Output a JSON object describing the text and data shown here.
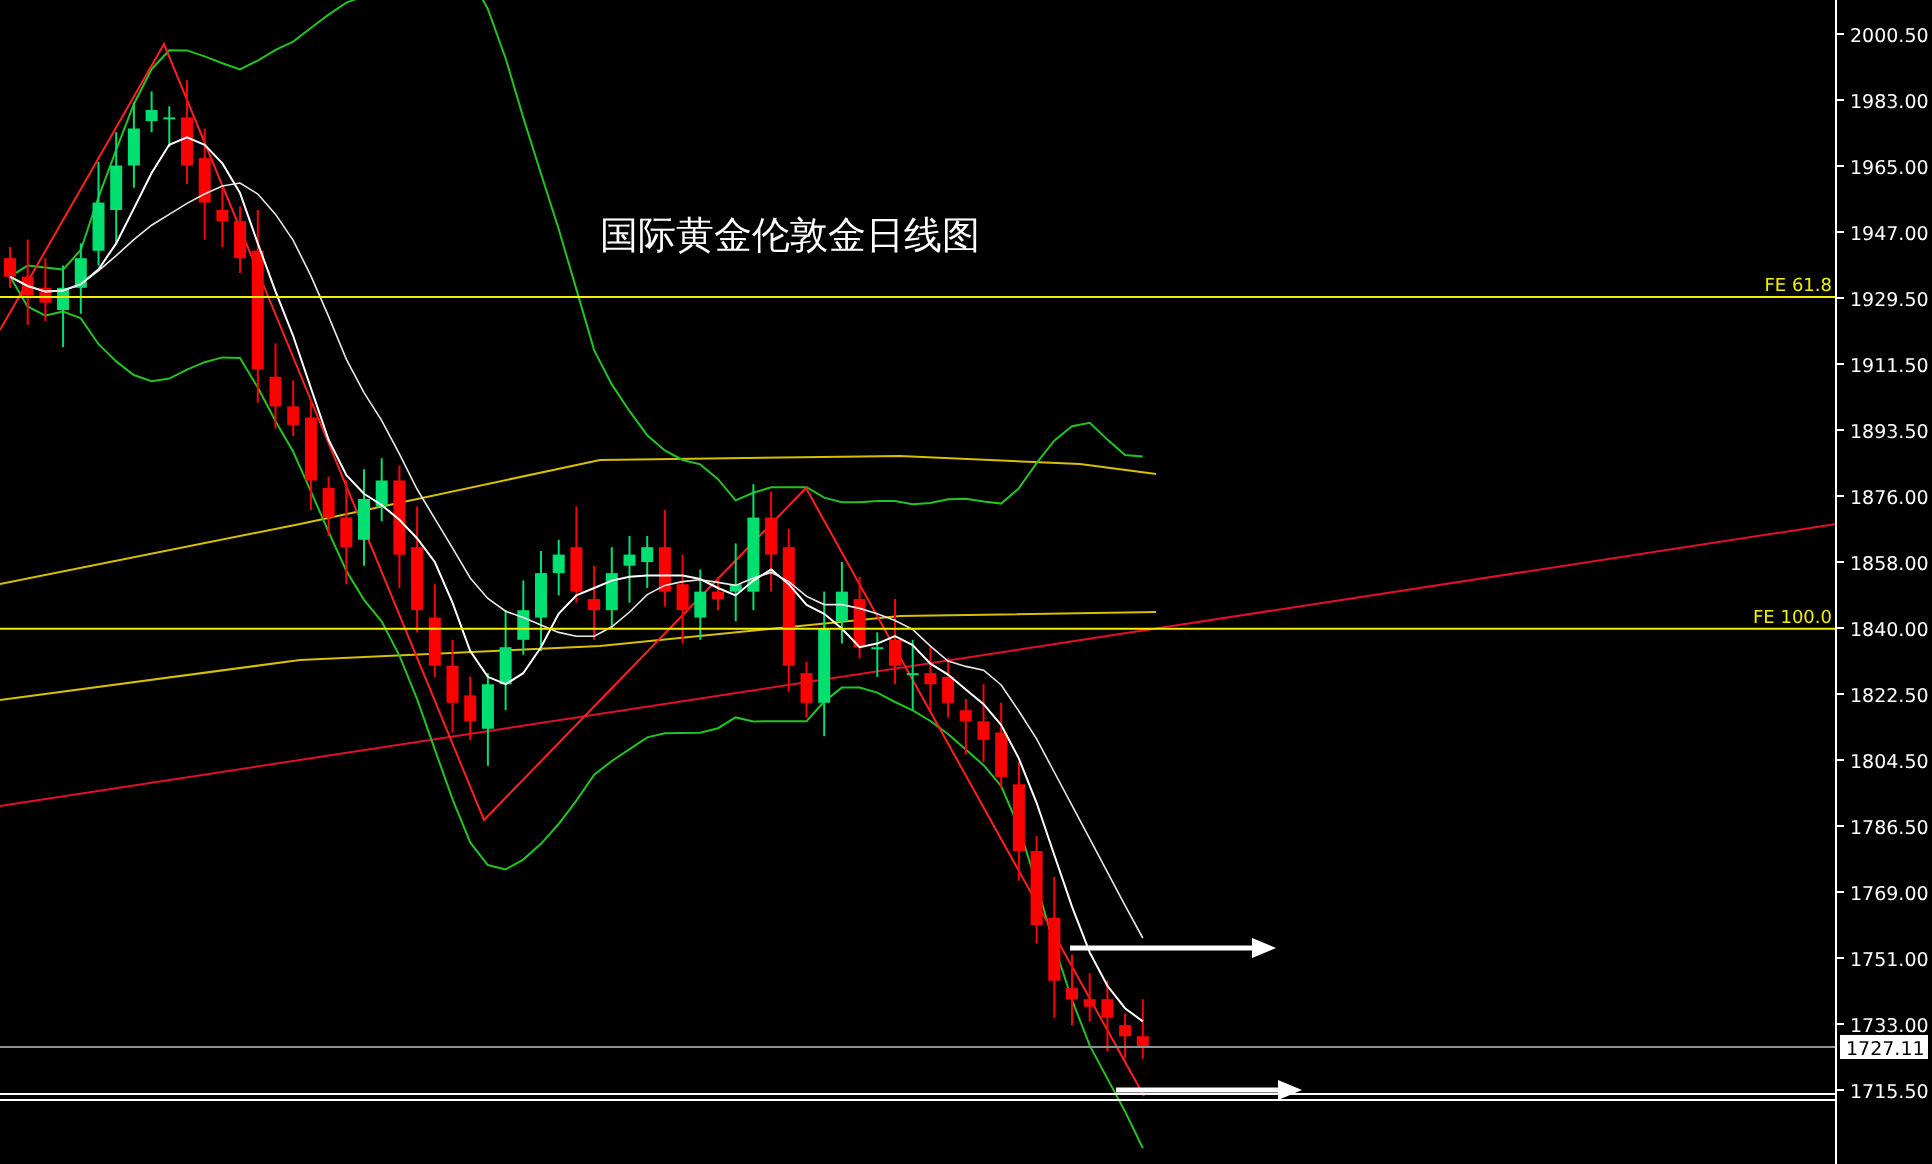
{
  "title": "国际黄金伦敦金日线图",
  "price_axis": {
    "ticks": [
      "2000.50",
      "1983.00",
      "1965.00",
      "1947.00",
      "1929.50",
      "1911.50",
      "1893.50",
      "1876.00",
      "1858.00",
      "1840.00",
      "1822.50",
      "1804.50",
      "1786.50",
      "1769.00",
      "1751.00",
      "1733.00",
      "1715.50"
    ]
  },
  "fib_levels": [
    {
      "label": "FE 61.8"
    },
    {
      "label": "FE 100.0"
    }
  ],
  "current_price": "1727.11"
}
